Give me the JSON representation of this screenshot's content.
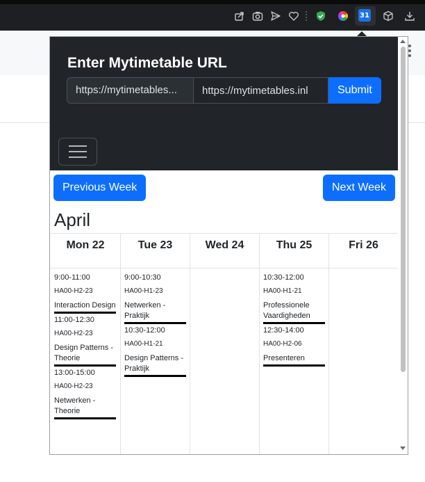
{
  "browser": {
    "extension_badge": "31",
    "toolbar_icons": [
      "share-icon",
      "camera-icon",
      "send-icon",
      "heart-icon",
      "shield-check-icon",
      "color-wheel-icon",
      "calendar-icon",
      "cube-icon",
      "download-icon"
    ],
    "accent_colors": {
      "shield": "#34a853",
      "calendar": "#1a73e8"
    }
  },
  "popup": {
    "title": "Enter Mytimetable URL",
    "url_select_value": "https://mytimetables...",
    "url_input_value": "https://mytimetables.inl",
    "submit_label": "Submit",
    "prev_week_label": "Previous Week",
    "next_week_label": "Next Week",
    "month": "April",
    "colors": {
      "header_bg": "#212529",
      "primary": "#0d6efd"
    }
  },
  "days": [
    {
      "label": "Mon 22",
      "events": [
        {
          "time": "9:00-11:00",
          "room": "HA00-H2-23",
          "name": "Interaction Design"
        },
        {
          "time": "11:00-12:30",
          "room": "HA00-H2-23",
          "name": "Design Patterns - Theorie"
        },
        {
          "time": "13:00-15:00",
          "room": "HA00-H2-23",
          "name": "Netwerken - Theorie"
        }
      ]
    },
    {
      "label": "Tue 23",
      "events": [
        {
          "time": "9:00-10:30",
          "room": "HA00-H1-23",
          "name": "Netwerken - Praktijk"
        },
        {
          "time": "10:30-12:00",
          "room": "HA00-H1-21",
          "name": "Design Patterns - Praktijk"
        }
      ]
    },
    {
      "label": "Wed 24",
      "events": []
    },
    {
      "label": "Thu 25",
      "events": [
        {
          "time": "10:30-12:00",
          "room": "HA00-H1-21",
          "name": "Professionele Vaardigheden"
        },
        {
          "time": "12:30-14:00",
          "room": "HA00-H2-06",
          "name": "Presenteren"
        }
      ]
    },
    {
      "label": "Fri 26",
      "events": []
    }
  ]
}
